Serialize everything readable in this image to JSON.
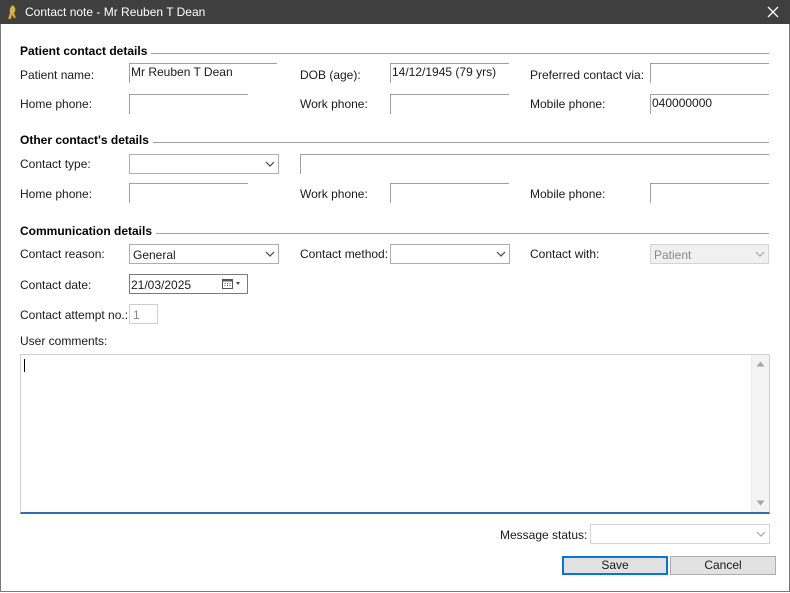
{
  "window": {
    "title": "Contact note - Mr Reuben T Dean",
    "close_icon": "close-icon",
    "app_icon": "app-logo-icon"
  },
  "patient_section": {
    "title": "Patient contact details",
    "patient_name_label": "Patient name:",
    "patient_name_value": "Mr Reuben T Dean",
    "dob_label": "DOB (age):",
    "dob_value": "14/12/1945 (79 yrs)",
    "preferred_contact_label": "Preferred contact via:",
    "preferred_contact_value": "",
    "home_phone_label": "Home phone:",
    "home_phone_value": "",
    "work_phone_label": "Work phone:",
    "work_phone_value": "",
    "mobile_phone_label": "Mobile phone:",
    "mobile_phone_value": "040000000"
  },
  "other_section": {
    "title": "Other contact's details",
    "contact_type_label": "Contact type:",
    "contact_type_value": "",
    "contact_name_value": "",
    "home_phone_label": "Home phone:",
    "home_phone_value": "",
    "work_phone_label": "Work phone:",
    "work_phone_value": "",
    "mobile_phone_label": "Mobile phone:",
    "mobile_phone_value": ""
  },
  "communication_section": {
    "title": "Communication details",
    "contact_reason_label": "Contact reason:",
    "contact_reason_value": "General",
    "contact_method_label": "Contact method:",
    "contact_method_value": "",
    "contact_with_label": "Contact with:",
    "contact_with_value": "Patient",
    "contact_date_label": "Contact date:",
    "contact_date_value": "21/03/2025",
    "attempt_label": "Contact attempt no.:",
    "attempt_value": "1",
    "comments_label": "User comments:",
    "comments_value": ""
  },
  "footer": {
    "message_status_label": "Message status:",
    "message_status_value": "",
    "save_label": "Save",
    "cancel_label": "Cancel"
  },
  "colors": {
    "titlebar": "#3f3f3f",
    "focus_accent": "#2d6db4",
    "default_button_border": "#0078d7"
  }
}
